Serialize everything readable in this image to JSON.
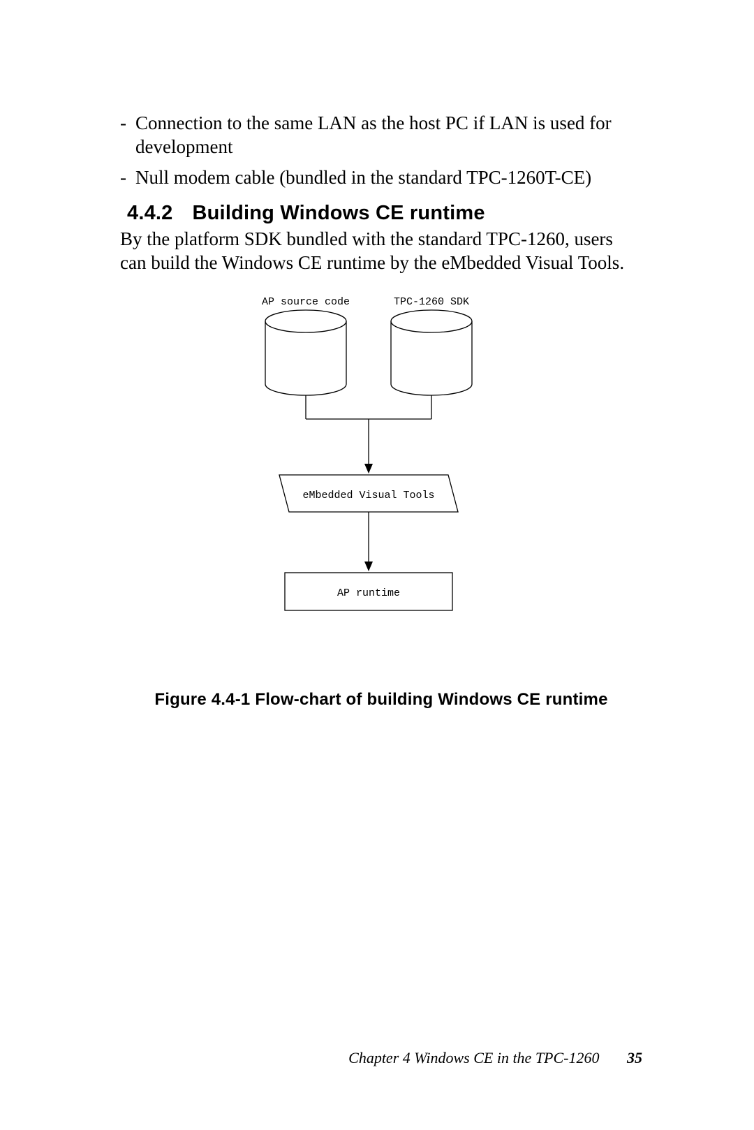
{
  "bullets": {
    "b1": "Connection to the same LAN as the host PC if LAN is used for development",
    "b2": "Null modem cable (bundled in the standard TPC-1260T-CE)"
  },
  "section": {
    "number": "4.4.2",
    "title": "Building Windows CE runtime"
  },
  "paragraph": "By the platform SDK bundled with the standard TPC-1260, users can build the Windows CE runtime by the eMbedded Visual Tools.",
  "figure_caption": "Figure 4.4-1  Flow-chart of building Windows CE runtime",
  "footer": {
    "chapter": "Chapter 4   Windows CE in the TPC-1260",
    "page": "35"
  },
  "chart_data": {
    "type": "diagram",
    "title": "Flow-chart of building Windows CE runtime",
    "nodes": [
      {
        "id": "ap_source",
        "shape": "cylinder",
        "label": "AP source code"
      },
      {
        "id": "sdk",
        "shape": "cylinder",
        "label": "TPC-1260 SDK"
      },
      {
        "id": "evt",
        "shape": "parallelogram",
        "label": "eMbedded Visual Tools"
      },
      {
        "id": "ap_runtime",
        "shape": "rectangle",
        "label": "AP runtime"
      }
    ],
    "edges": [
      {
        "from": "ap_source",
        "to": "evt"
      },
      {
        "from": "sdk",
        "to": "evt"
      },
      {
        "from": "evt",
        "to": "ap_runtime"
      }
    ]
  }
}
